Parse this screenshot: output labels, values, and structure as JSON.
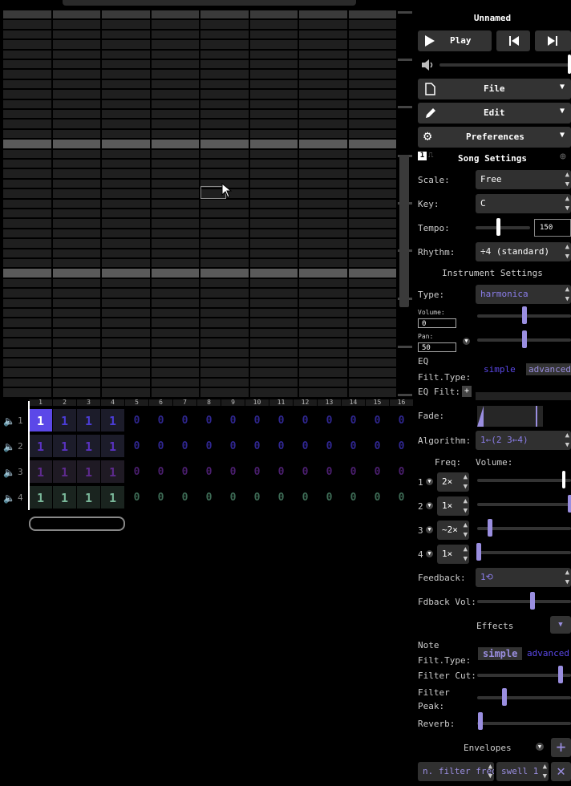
{
  "song": {
    "title": "Unnamed"
  },
  "transport": {
    "play_label": "Play"
  },
  "menus": {
    "file": "File",
    "edit": "Edit",
    "preferences": "Preferences"
  },
  "song_settings": {
    "heading": "Song Settings",
    "scale_label": "Scale:",
    "scale_value": "Free",
    "key_label": "Key:",
    "key_value": "C",
    "tempo_label": "Tempo:",
    "tempo_value": "150",
    "rhythm_label": "Rhythm:",
    "rhythm_value": "÷4 (standard)"
  },
  "instrument": {
    "heading": "Instrument Settings",
    "type_label": "Type:",
    "type_value": "harmonica",
    "volume_label": "Volume:",
    "volume_value": "0",
    "pan_label": "Pan:",
    "pan_value": "50",
    "eq_label": "EQ",
    "filt_type_label": "Filt.Type:",
    "simple": "simple",
    "advanced": "advanced",
    "eq_filt_label": "EQ Filt:",
    "fade_label": "Fade:",
    "algorithm_label": "Algorithm:",
    "algorithm_value": "1←(2 3←4)",
    "freq_label": "Freq:",
    "vol_label": "Volume:",
    "operators": [
      {
        "n": "1",
        "freq": "2×"
      },
      {
        "n": "2",
        "freq": "1×"
      },
      {
        "n": "3",
        "freq": "~2×"
      },
      {
        "n": "4",
        "freq": "1×"
      }
    ],
    "feedback_label": "Feedback:",
    "feedback_value": "1⟲",
    "fdback_vol_label": "Fdback Vol:",
    "effects_label": "Effects",
    "note_label": "Note",
    "note_filt_type_label": "Filt.Type:",
    "filter_cut_label": "Filter Cut:",
    "filter_peak_label": "Filter",
    "filter_peak_label2": "Peak:",
    "reverb_label": "Reverb:",
    "envelopes_label": "Envelopes",
    "env_target": "n. filter freq",
    "env_type": "swell 1"
  },
  "pattern": {
    "bars": [
      "1",
      "2",
      "3",
      "4",
      "5",
      "6",
      "7",
      "8",
      "9",
      "10",
      "11",
      "12",
      "13",
      "14",
      "15",
      "16"
    ],
    "channels": [
      {
        "n": "1",
        "cells": [
          "1",
          "1",
          "1",
          "1",
          "0",
          "0",
          "0",
          "0",
          "0",
          "0",
          "0",
          "0",
          "0",
          "0",
          "0",
          "0"
        ]
      },
      {
        "n": "2",
        "cells": [
          "1",
          "1",
          "1",
          "1",
          "0",
          "0",
          "0",
          "0",
          "0",
          "0",
          "0",
          "0",
          "0",
          "0",
          "0",
          "0"
        ]
      },
      {
        "n": "3",
        "cells": [
          "1",
          "1",
          "1",
          "1",
          "0",
          "0",
          "0",
          "0",
          "0",
          "0",
          "0",
          "0",
          "0",
          "0",
          "0",
          "0"
        ]
      },
      {
        "n": "4",
        "cells": [
          "1",
          "1",
          "1",
          "1",
          "0",
          "0",
          "0",
          "0",
          "0",
          "0",
          "0",
          "0",
          "0",
          "0",
          "0",
          "0"
        ]
      }
    ]
  },
  "colors": {
    "accent": "#9a8ee0",
    "selected": "#5b48e8"
  },
  "icons": [
    "play-icon",
    "prev-icon",
    "next-icon",
    "volume-icon",
    "file-icon",
    "pencil-icon",
    "gear-icon",
    "mute-icon"
  ]
}
